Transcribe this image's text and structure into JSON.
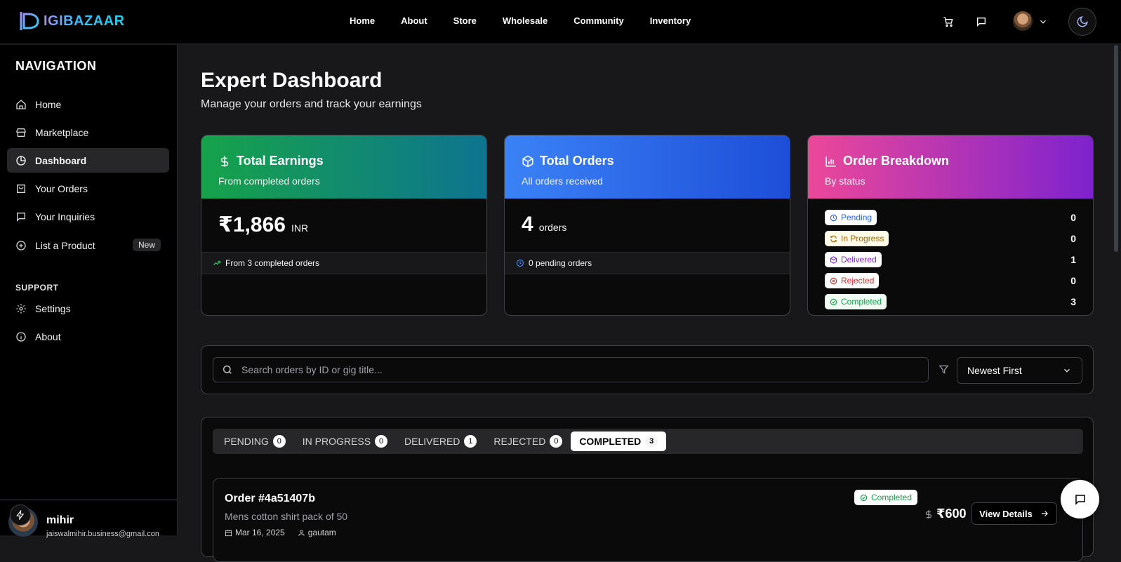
{
  "brand": {
    "name": "IGIBAZAAR"
  },
  "topnav": [
    "Home",
    "About",
    "Store",
    "Wholesale",
    "Community",
    "Inventory"
  ],
  "sidebar": {
    "title": "NAVIGATION",
    "items": [
      {
        "label": "Home",
        "icon": "home-icon"
      },
      {
        "label": "Marketplace",
        "icon": "store-icon"
      },
      {
        "label": "Dashboard",
        "icon": "pie-chart-icon",
        "active": true
      },
      {
        "label": "Your Orders",
        "icon": "shopping-bag-icon"
      },
      {
        "label": "Your Inquiries",
        "icon": "message-icon"
      },
      {
        "label": "List a Product",
        "icon": "plus-circle-icon",
        "badge": "New"
      }
    ],
    "support_title": "SUPPORT",
    "support_items": [
      {
        "label": "Settings",
        "icon": "gear-icon"
      },
      {
        "label": "About",
        "icon": "info-icon"
      }
    ],
    "user": {
      "name": "mihir",
      "email": "jaiswalmihir.business@gmail.com"
    }
  },
  "page": {
    "title": "Expert Dashboard",
    "subtitle": "Manage your orders and track your earnings"
  },
  "cards": {
    "earnings": {
      "title": "Total Earnings",
      "subtitle": "From completed orders",
      "value": "₹1,866",
      "unit": "INR",
      "footer": "From 3 completed orders",
      "color": "#16a34a"
    },
    "orders": {
      "title": "Total Orders",
      "subtitle": "All orders received",
      "value": "4",
      "unit": "orders",
      "footer": "0 pending orders",
      "color": "#3b82f6"
    },
    "breakdown": {
      "title": "Order Breakdown",
      "subtitle": "By status",
      "rows": [
        {
          "label": "Pending",
          "value": "0",
          "color": "#2563eb"
        },
        {
          "label": "In Progress",
          "value": "0",
          "color": "#a16207"
        },
        {
          "label": "Delivered",
          "value": "1",
          "color": "#7e22ce"
        },
        {
          "label": "Rejected",
          "value": "0",
          "color": "#dc2626"
        },
        {
          "label": "Completed",
          "value": "3",
          "color": "#16a34a"
        }
      ]
    }
  },
  "search": {
    "placeholder": "Search orders by ID or gig title...",
    "sort": "Newest First"
  },
  "tabs": [
    {
      "label": "PENDING",
      "count": "0"
    },
    {
      "label": "IN PROGRESS",
      "count": "0"
    },
    {
      "label": "DELIVERED",
      "count": "1"
    },
    {
      "label": "REJECTED",
      "count": "0"
    },
    {
      "label": "COMPLETED",
      "count": "3",
      "active": true
    }
  ],
  "order": {
    "id": "Order #4a51407b",
    "title": "Mens cotton shirt pack of 50",
    "date": "Mar 16, 2025",
    "customer": "gautam",
    "status": "Completed",
    "price": "₹600",
    "view_label": "View Details"
  }
}
